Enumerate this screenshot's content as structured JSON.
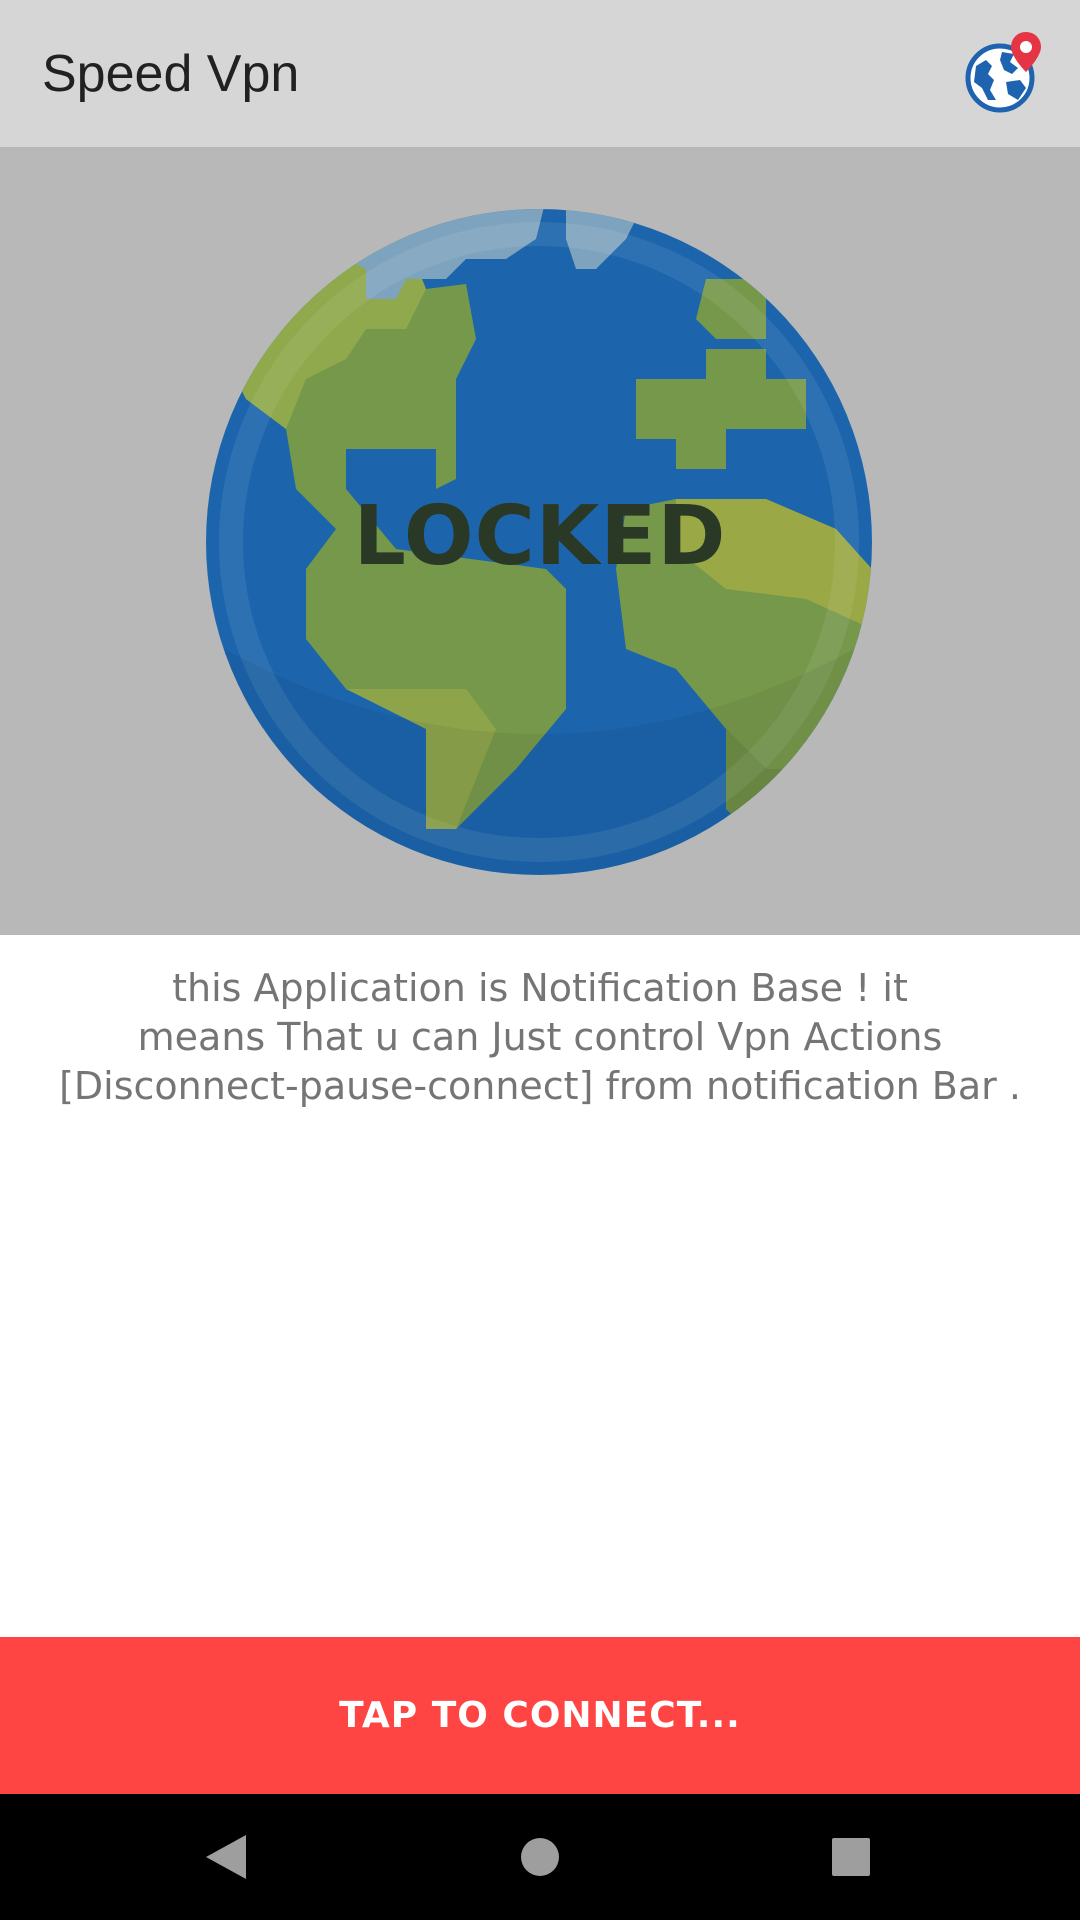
{
  "app_bar": {
    "title": "Speed Vpn",
    "server_icon": "globe-location-pin-icon"
  },
  "hero": {
    "status_label": "LOCKED",
    "globe_icon": "earth-globe-icon"
  },
  "info": {
    "lines": [
      "this Application is Notification Base ! it",
      "means That u can Just control Vpn Actions",
      "[Disconnect-pause-connect] from notification Bar ."
    ]
  },
  "connect_button": {
    "label": "TAP TO CONNECT..."
  },
  "nav_bar": {
    "back_icon": "back-triangle-icon",
    "home_icon": "home-circle-icon",
    "recents_icon": "recents-square-icon"
  },
  "colors": {
    "app_bar_bg": "#d6d6d6",
    "hero_bg": "#b8b8b8",
    "accent_red": "#ff4444",
    "globe_ocean": "#1f67ad",
    "globe_land": "#76984b"
  }
}
